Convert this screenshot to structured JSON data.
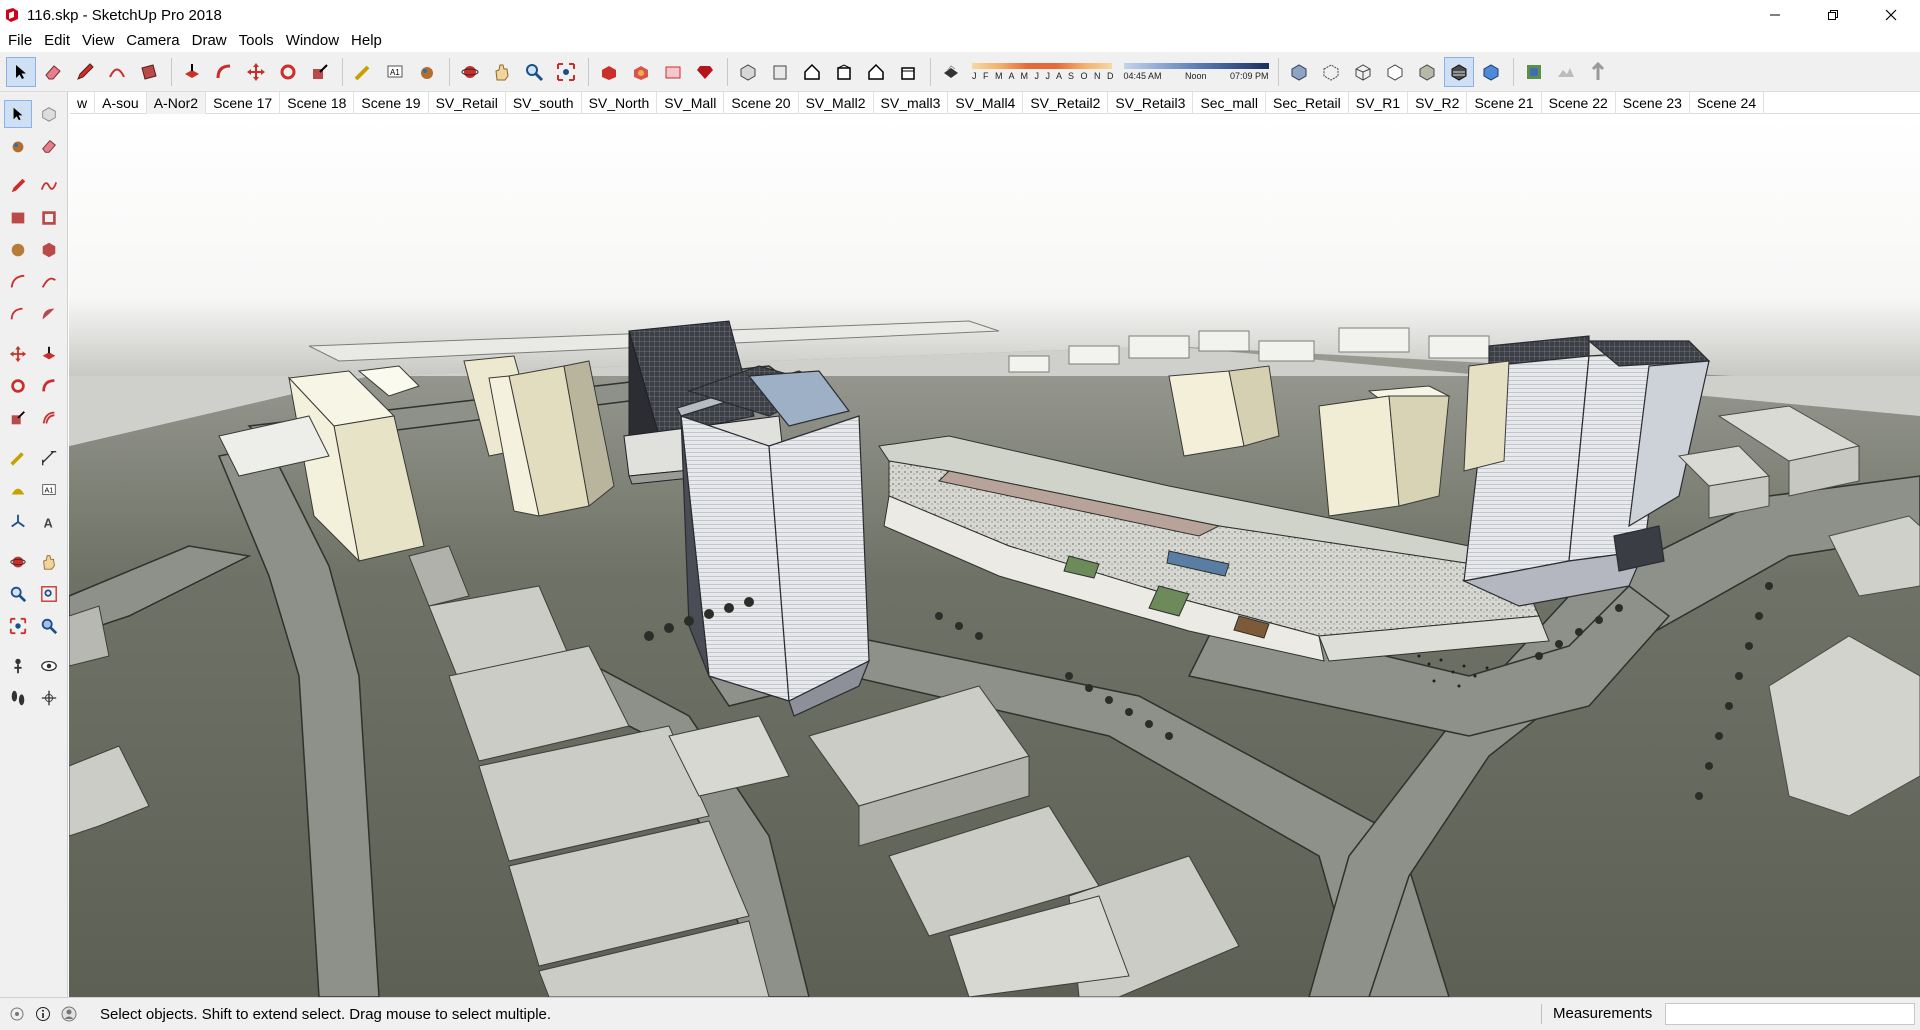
{
  "window": {
    "title": "116.skp - SketchUp Pro 2018"
  },
  "menu": [
    "File",
    "Edit",
    "View",
    "Camera",
    "Draw",
    "Tools",
    "Window",
    "Help"
  ],
  "shadow": {
    "months": "J F M A M J J A S O N D",
    "time_start": "04:45 AM",
    "time_mid": "Noon",
    "time_end": "07:09 PM"
  },
  "scenes": [
    "w",
    "A-sou",
    "A-Nor2",
    "Scene 17",
    "Scene 18",
    "Scene 19",
    "SV_Retail",
    "SV_south",
    "SV_North",
    "SV_Mall",
    "Scene 20",
    "SV_Mall2",
    "SV_mall3",
    "SV_Mall4",
    "SV_Retail2",
    "SV_Retail3",
    "Sec_mall",
    "Sec_Retail",
    "SV_R1",
    "SV_R2",
    "Scene 21",
    "Scene 22",
    "Scene 23",
    "Scene 24"
  ],
  "active_scene": "A-Nor2",
  "status": {
    "message": "Select objects. Shift to extend select. Drag mouse to select multiple.",
    "measurements_label": "Measurements",
    "measurements_value": ""
  },
  "colors": {
    "ground": "#6b6e62",
    "road": "#8c8f86",
    "building_light": "#e9e6d3",
    "glass_tower": "#d9dde3",
    "sky_top": "#ffffff",
    "sky_horizon": "#c9c9c7",
    "accent_select": "#cfe0f5"
  }
}
